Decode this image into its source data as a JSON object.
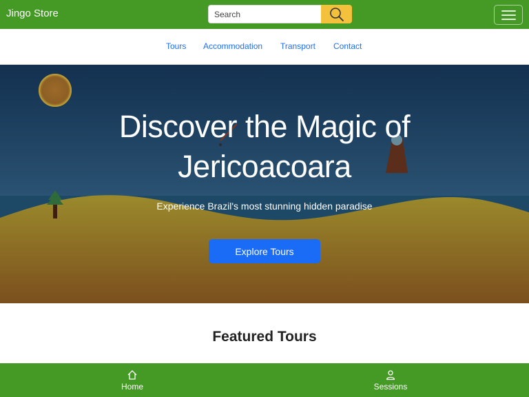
{
  "header": {
    "brand": "Jingo Store",
    "search_placeholder": "Search",
    "search_icon": "search-icon",
    "menu_icon": "hamburger-icon"
  },
  "nav": {
    "items": [
      "Tours",
      "Accommodation",
      "Transport",
      "Contact"
    ]
  },
  "hero": {
    "title_line1": "Discover the Magic of",
    "title_line2": "Jericoacoara",
    "subtitle": "Experience Brazil's most stunning hidden paradise",
    "cta": "Explore Tours"
  },
  "section": {
    "title": "Featured Tours"
  },
  "bottom_nav": {
    "items": [
      {
        "label": "Home",
        "icon": "home-icon"
      },
      {
        "label": "Sessions",
        "icon": "person-icon"
      }
    ]
  },
  "colors": {
    "brand_green": "#459a26",
    "search_button": "#f4c13c",
    "link_blue": "#1d6ef3",
    "cta_blue": "#1a6cf6"
  }
}
